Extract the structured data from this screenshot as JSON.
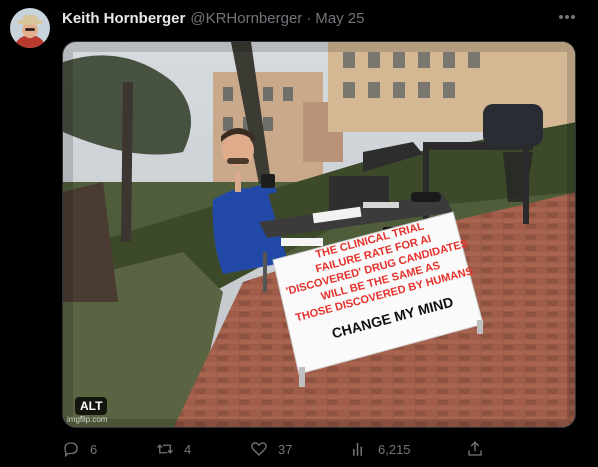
{
  "tweet": {
    "author_name": "Keith Hornberger",
    "author_handle": "@KRHornberger",
    "separator": "·",
    "date": "May 25",
    "more_icon": "ellipsis-icon"
  },
  "media": {
    "alt_badge": "ALT",
    "watermark": "imgflip.com",
    "sign_lines": [
      "THE CLINICAL TRIAL",
      "FAILURE RATE FOR AI",
      "'DISCOVERED' DRUG CANDIDATES",
      "WILL BE THE SAME AS",
      "THOSE DISCOVERED BY HUMANS"
    ],
    "sign_footer": "CHANGE MY MIND",
    "sign_text_color": "#e8302a"
  },
  "actions": {
    "reply": {
      "icon": "reply-icon",
      "count": "6"
    },
    "repost": {
      "icon": "repost-icon",
      "count": "4"
    },
    "like": {
      "icon": "heart-icon",
      "count": "37"
    },
    "views": {
      "icon": "views-icon",
      "count": "6,215"
    },
    "share": {
      "icon": "share-icon"
    }
  },
  "colors": {
    "background": "#000000",
    "primary_text": "#e7e9ea",
    "secondary_text": "#71767b"
  }
}
